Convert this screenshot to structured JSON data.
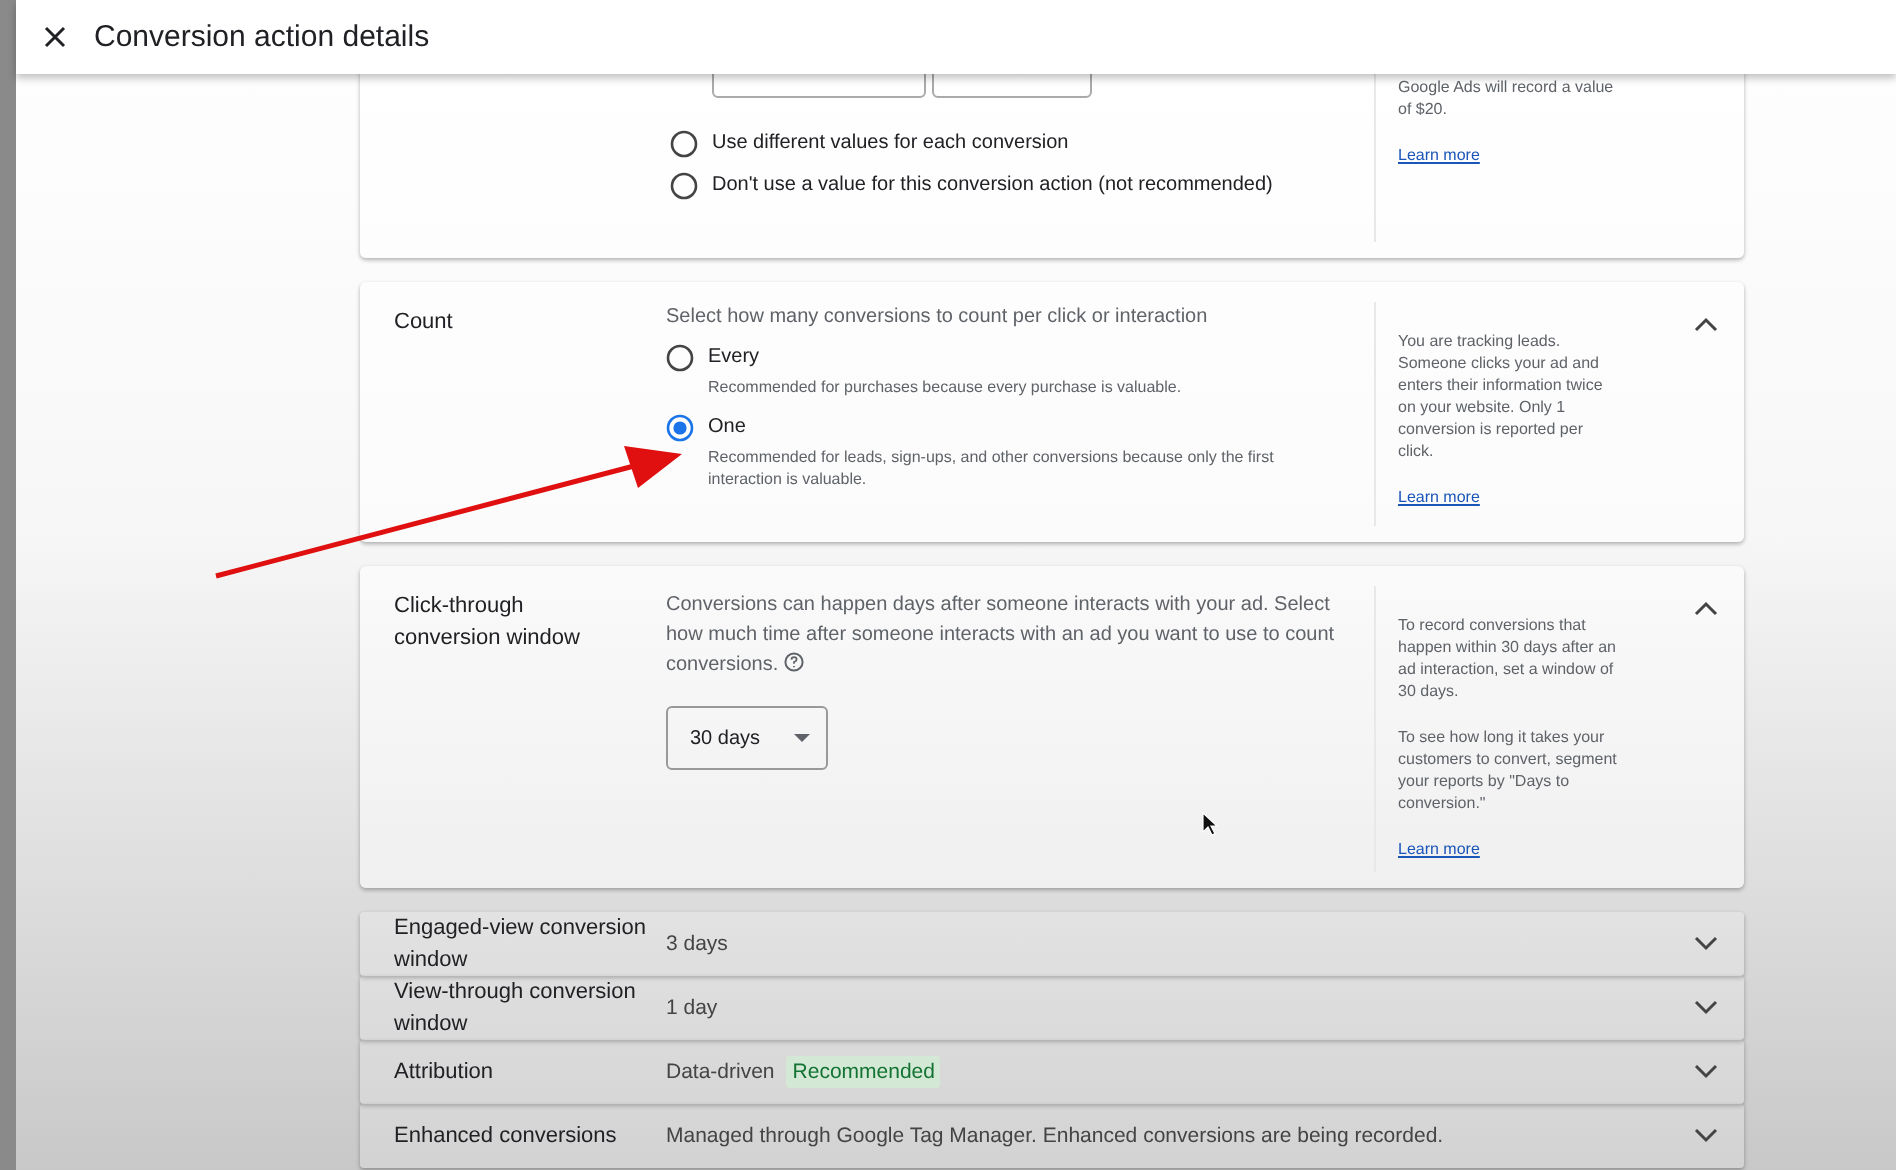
{
  "header": {
    "title": "Conversion action details"
  },
  "value_section": {
    "options": [
      {
        "label": "Use different values for each conversion",
        "selected": false
      },
      {
        "label": "Don't use a value for this conversion action (not recommended)",
        "selected": false
      }
    ],
    "help": "Google Ads will record a value of $20.",
    "help_link": "Learn more"
  },
  "count": {
    "label": "Count",
    "expanded": true,
    "prompt": "Select how many conversions to count per click or interaction",
    "options": [
      {
        "label": "Every",
        "description": "Recommended for purchases because every purchase is valuable.",
        "selected": false
      },
      {
        "label": "One",
        "description": "Recommended for leads, sign-ups, and other conversions because only the first interaction is valuable.",
        "selected": true
      }
    ],
    "help": "You are tracking leads. Someone clicks your ad and enters their information twice on your website. Only 1 conversion is reported per click.",
    "help_link": "Learn more"
  },
  "click_through": {
    "label": "Click-through conversion window",
    "expanded": true,
    "description": "Conversions can happen days after someone interacts with your ad. Select how much time after someone interacts with an ad you want to use to count conversions.",
    "dropdown": "30 days",
    "help": [
      "To record conversions that happen within 30 days after an ad interaction, set a window of 30 days.",
      "To see how long it takes your customers to convert, segment your reports by \"Days to conversion.\""
    ],
    "help_link": "Learn more"
  },
  "settings": [
    {
      "label": "Engaged-view conversion window",
      "value": "3 days",
      "expanded": false
    },
    {
      "label": "View-through conversion window",
      "value": "1 day",
      "expanded": false
    },
    {
      "label": "Attribution",
      "value": "Data-driven",
      "badge": "Recommended",
      "expanded": false
    },
    {
      "label": "Enhanced conversions",
      "value": "Managed through Google Tag Manager. Enhanced conversions are being recorded.",
      "expanded": false
    }
  ]
}
